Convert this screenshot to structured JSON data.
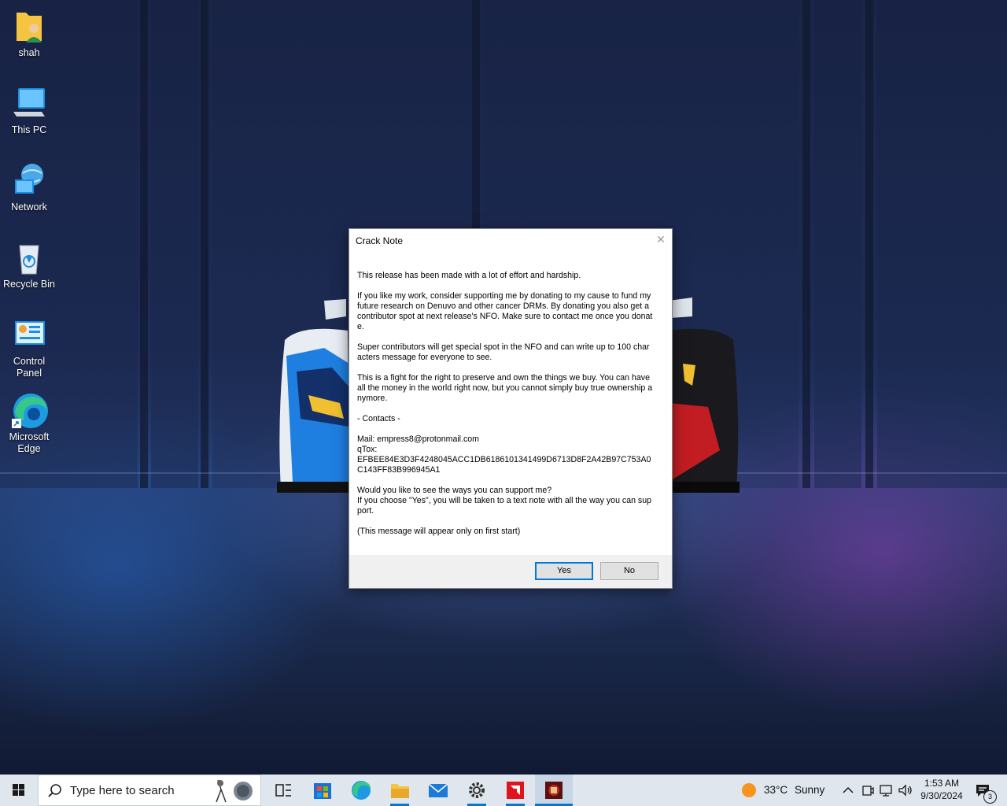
{
  "desktop": {
    "icons": [
      {
        "label": "shah"
      },
      {
        "label": "This PC"
      },
      {
        "label": "Network"
      },
      {
        "label": "Recycle Bin"
      },
      {
        "label": "Control Panel"
      },
      {
        "label": "Microsoft Edge"
      }
    ]
  },
  "dialog": {
    "title": "Crack Note",
    "close_icon": "close-icon",
    "paragraphs": [
      "This release has been made with a lot of effort and hardship.",
      "If you like my work, consider supporting me by donating to my cause to fund my future research on Denuvo and other cancer DRMs. By donating you also get a contributor spot at next release's NFO. Make sure to contact me once you donate.",
      "Super contributors will get special spot in the NFO and can write up to 100 characters message for everyone to see.",
      "This is a fight for the right to preserve and own the things we buy. You can have all the money in the world right now, but you cannot simply buy true ownership anymore.",
      "- Contacts -",
      "Mail: empress8@protonmail.com\nqTox:\nEFBEE84E3D3F4248045ACC1DB6186101341499D6713D8F2A42B97C753A0C143FF83B996945A1",
      "Would you like to see the ways you can support me?\nIf you choose \"Yes\", you will be taken to a text note with all the way you can support.",
      "(This message will appear only on first start)"
    ],
    "yes_label": "Yes",
    "no_label": "No"
  },
  "taskbar": {
    "search_placeholder": "Type here to search",
    "weather_temp": "33°C",
    "weather_desc": "Sunny",
    "time": "1:53 AM",
    "date": "9/30/2024",
    "notification_count": "3",
    "apps": [
      "task-view",
      "microsoft-store",
      "microsoft-edge",
      "file-explorer",
      "mail",
      "settings",
      "amd-software",
      "game"
    ]
  }
}
